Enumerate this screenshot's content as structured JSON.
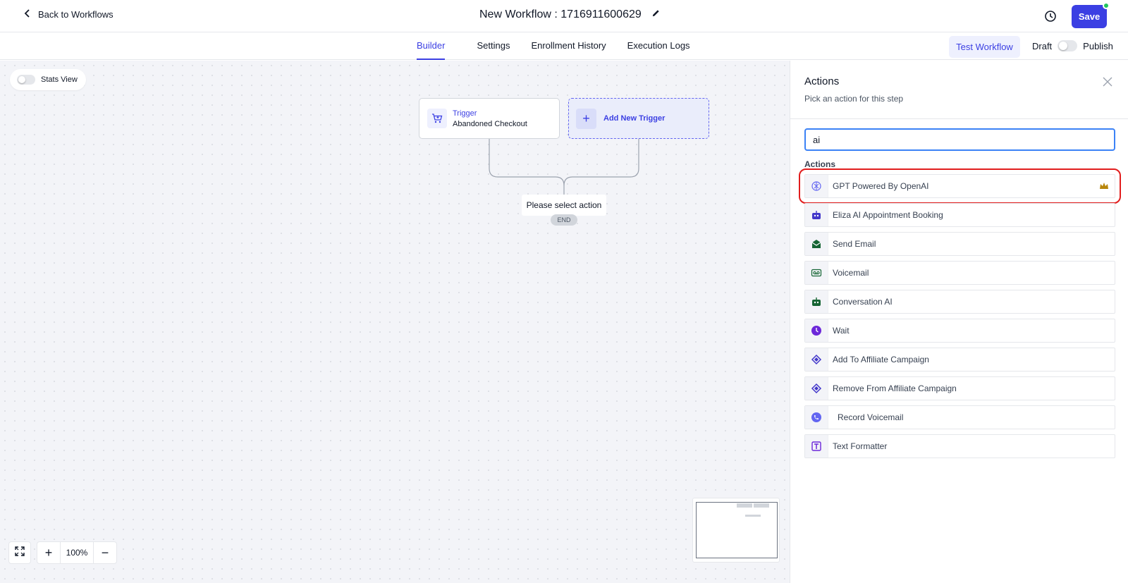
{
  "header": {
    "back_label": "Back to Workflows",
    "workflow_title": "New Workflow : 1716911600629",
    "save_label": "Save"
  },
  "tabs": [
    {
      "label": "Builder",
      "active": true
    },
    {
      "label": "Settings",
      "active": false
    },
    {
      "label": "Enrollment History",
      "active": false
    },
    {
      "label": "Execution Logs",
      "active": false
    }
  ],
  "toolbar": {
    "test_label": "Test Workflow",
    "draft_label": "Draft",
    "publish_label": "Publish"
  },
  "canvas": {
    "stats_view_label": "Stats View",
    "trigger_title": "Trigger",
    "trigger_name": "Abandoned Checkout",
    "add_trigger_label": "Add New Trigger",
    "select_action_label": "Please select action",
    "end_label": "END",
    "zoom_level": "100%"
  },
  "panel": {
    "title": "Actions",
    "subtitle": "Pick an action for this step",
    "search_value": "ai",
    "section_label": "Actions",
    "items": [
      {
        "label": "GPT Powered By OpenAI",
        "icon": "openai-icon",
        "color": "#6366f1",
        "premium": true
      },
      {
        "label": "Eliza AI Appointment Booking",
        "icon": "robot-icon",
        "color": "#4338ca",
        "premium": false
      },
      {
        "label": "Send Email",
        "icon": "email-icon",
        "color": "#166534",
        "premium": false
      },
      {
        "label": "Voicemail",
        "icon": "voicemail-icon",
        "color": "#166534",
        "premium": false
      },
      {
        "label": "Conversation AI",
        "icon": "robot-icon",
        "color": "#166534",
        "premium": false
      },
      {
        "label": "Wait",
        "icon": "clock-icon",
        "color": "#6d28d9",
        "premium": false
      },
      {
        "label": "Add To Affiliate Campaign",
        "icon": "affiliate-icon",
        "color": "#4338ca",
        "premium": false
      },
      {
        "label": "Remove From Affiliate Campaign",
        "icon": "affiliate-icon",
        "color": "#4338ca",
        "premium": false
      },
      {
        "label": "Record Voicemail",
        "icon": "phone-icon",
        "color": "#6366f1",
        "premium": false
      },
      {
        "label": "Text Formatter",
        "icon": "text-format-icon",
        "color": "#6d28d9",
        "premium": false
      }
    ]
  },
  "colors": {
    "accent": "#3b3fe3",
    "highlight": "#e11d1d",
    "canvas_bg": "#f3f4f8"
  }
}
